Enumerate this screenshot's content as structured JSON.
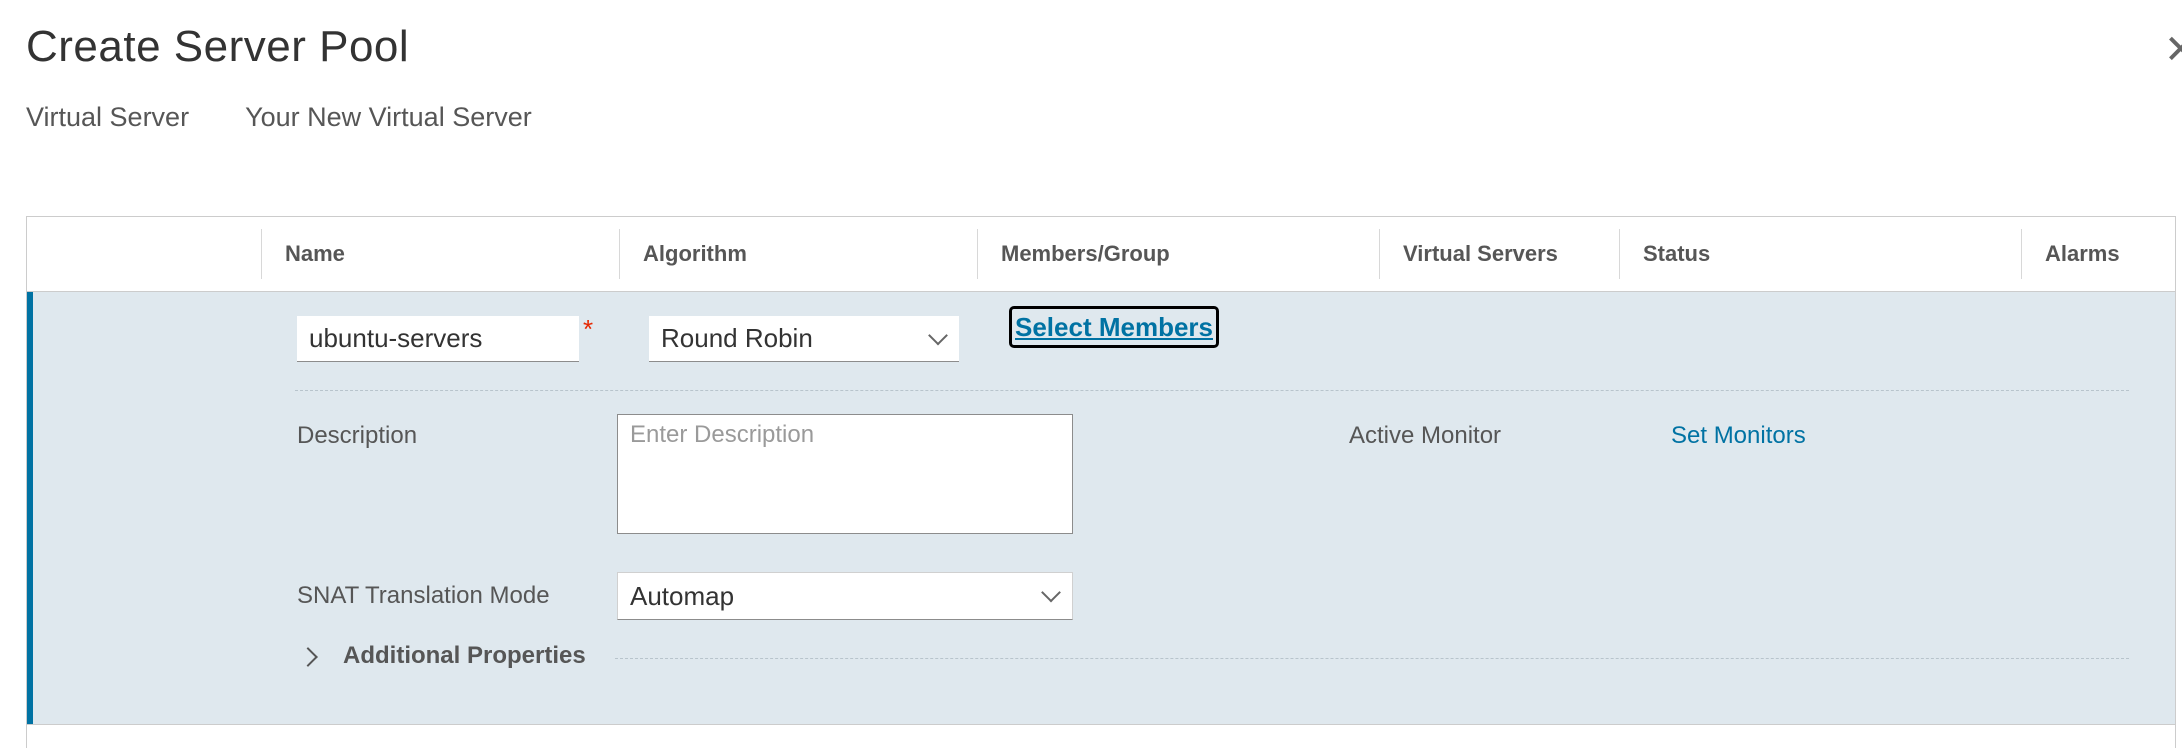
{
  "dialog": {
    "title": "Create Server Pool",
    "close_glyph": "✕",
    "subtitle_label": "Virtual Server",
    "subtitle_value": "Your New Virtual Server"
  },
  "grid": {
    "columns": [
      "Name",
      "Algorithm",
      "Members/Group",
      "Virtual Servers",
      "Status",
      "Alarms"
    ]
  },
  "row": {
    "name_value": "ubuntu-servers",
    "required_marker": "*",
    "algorithm_value": "Round Robin",
    "select_members_label": "Select Members",
    "description_label": "Description",
    "description_placeholder": "Enter Description",
    "active_monitor_label": "Active Monitor",
    "set_monitors_label": "Set Monitors",
    "snat_label": "SNAT Translation Mode",
    "snat_value": "Automap",
    "additional_properties_label": "Additional Properties"
  },
  "colors": {
    "accent": "#0072a3",
    "row_background": "#dfe8ee",
    "required": "#e62700"
  }
}
